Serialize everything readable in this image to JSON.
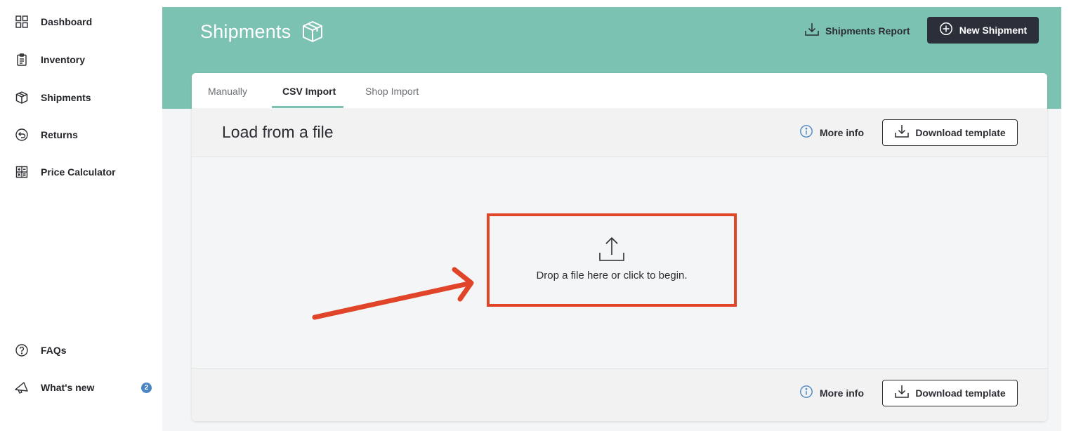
{
  "sidebar": {
    "items": [
      {
        "label": "Dashboard",
        "icon": "dashboard-icon"
      },
      {
        "label": "Inventory",
        "icon": "clipboard-icon"
      },
      {
        "label": "Shipments",
        "icon": "box-icon"
      },
      {
        "label": "Returns",
        "icon": "return-icon"
      },
      {
        "label": "Price Calculator",
        "icon": "calculator-icon"
      }
    ],
    "bottom_items": [
      {
        "label": "FAQs",
        "icon": "question-icon"
      },
      {
        "label": "What's new",
        "icon": "megaphone-icon",
        "badge": "2"
      }
    ]
  },
  "header": {
    "title": "Shipments",
    "report_label": "Shipments Report",
    "new_label": "New Shipment",
    "banner_color": "#7cc2b3",
    "new_button_color": "#2b2f3a"
  },
  "tabs": [
    {
      "label": "Manually",
      "active": false
    },
    {
      "label": "CSV Import",
      "active": true
    },
    {
      "label": "Shop Import",
      "active": false
    }
  ],
  "section": {
    "title": "Load from a file",
    "more_info": "More info",
    "download": "Download template"
  },
  "dropzone": {
    "text": "Drop a file here or click to begin.",
    "highlight_color": "#e0452a"
  },
  "footer": {
    "more_info": "More info",
    "download": "Download template"
  }
}
